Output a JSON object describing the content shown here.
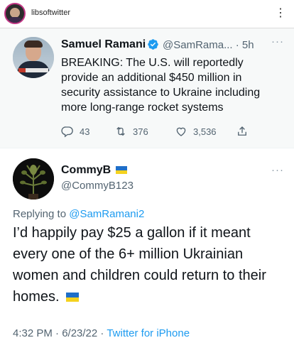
{
  "instagram": {
    "username": "libsoftwitter",
    "more_label": "⋮"
  },
  "quoted_tweet": {
    "author_name": "Samuel Ramani",
    "handle_time": "@SamRama... · 5h",
    "more_label": "···",
    "text": "BREAKING: The U.S. will reportedly provide an additional $450 million in security assistance to Ukraine including more long-range rocket systems",
    "replies": "43",
    "retweets": "376",
    "likes": "3,536",
    "icons": {
      "verified": "verified-badge-icon",
      "reply": "reply-icon",
      "retweet": "retweet-icon",
      "like": "heart-icon",
      "share": "share-icon"
    },
    "colors": {
      "verified": "#1d9bf0"
    }
  },
  "tweet": {
    "author_name": "CommyB",
    "handle": "@CommyB123",
    "more_label": "···",
    "replying_prefix": "Replying to ",
    "replying_to": "@SamRamani2",
    "body": "I’d happily pay $25 a gallon if it meant every one of the 6+ million Ukrainian women and children could return to their homes.",
    "timestamp": "4:32 PM · 6/23/22 · ",
    "client": "Twitter for iPhone",
    "colors": {
      "flag_blue": "#1f6fc8",
      "flag_yellow": "#f4d21f",
      "link": "#1d9bf0"
    }
  }
}
